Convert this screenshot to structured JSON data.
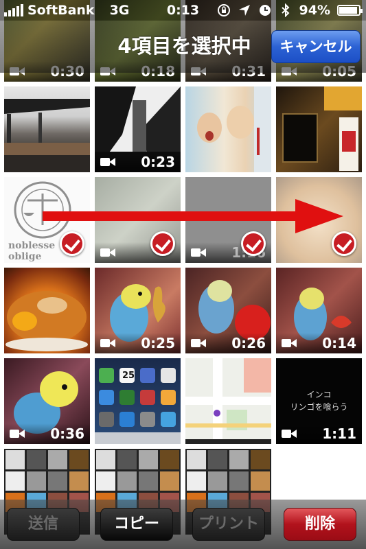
{
  "status_bar": {
    "carrier": "SoftBank",
    "network": "3G",
    "time": "0:13",
    "battery": "94%",
    "battery_level": 0.94,
    "icons": [
      "signal-icon",
      "rotation-lock-icon",
      "location-icon",
      "alarm-icon",
      "bluetooth-icon",
      "battery-icon"
    ]
  },
  "nav": {
    "title": "4項目を選択中",
    "cancel_label": "キャンセル"
  },
  "grid": {
    "columns": 4,
    "rows": [
      {
        "items": [
          {
            "type": "video",
            "duration": "0:30"
          },
          {
            "type": "video",
            "duration": "0:18"
          },
          {
            "type": "video",
            "duration": "0:31"
          },
          {
            "type": "video",
            "duration": "0:05"
          }
        ]
      },
      {
        "items": [
          {
            "type": "photo"
          },
          {
            "type": "video",
            "duration": "0:23"
          },
          {
            "type": "photo"
          },
          {
            "type": "photo"
          }
        ]
      },
      {
        "items": [
          {
            "type": "photo",
            "selected": true,
            "caption": "noblesse oblige"
          },
          {
            "type": "video",
            "selected": true
          },
          {
            "type": "video",
            "duration": "1:16",
            "selected": true
          },
          {
            "type": "photo",
            "selected": true
          }
        ]
      },
      {
        "items": [
          {
            "type": "photo"
          },
          {
            "type": "video",
            "duration": "0:25"
          },
          {
            "type": "video",
            "duration": "0:26"
          },
          {
            "type": "video",
            "duration": "0:14"
          }
        ]
      },
      {
        "items": [
          {
            "type": "video",
            "duration": "0:36"
          },
          {
            "type": "photo",
            "date": "25"
          },
          {
            "type": "photo"
          },
          {
            "type": "video",
            "duration": "1:11",
            "text1": "インコ",
            "text2": "リンゴを喰らう"
          }
        ]
      },
      {
        "items": [
          {
            "type": "photo"
          },
          {
            "type": "photo"
          },
          {
            "type": "photo"
          }
        ]
      }
    ]
  },
  "toolbar": {
    "send": "送信",
    "copy": "コピー",
    "print": "プリント",
    "delete": "削除"
  },
  "colors": {
    "cancel_blue": "#2c62d4",
    "delete_red": "#b2121c",
    "check_red": "#c71d24",
    "arrow_red": "#e01010"
  }
}
